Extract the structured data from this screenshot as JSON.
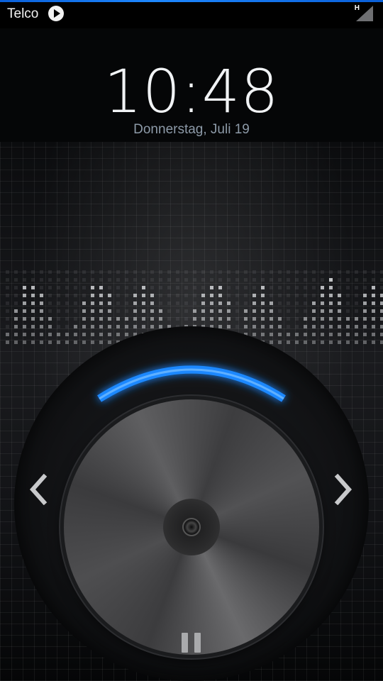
{
  "status_bar": {
    "carrier": "Telco",
    "network_indicator": "H",
    "icons": [
      "play-notification-icon",
      "signal-icon"
    ]
  },
  "lockscreen": {
    "time": "10:48",
    "date": "Donnerstag, Juli 19"
  },
  "player": {
    "controls": [
      "previous-icon",
      "next-icon",
      "pause-icon"
    ],
    "accent_color": "#1e88ff"
  }
}
